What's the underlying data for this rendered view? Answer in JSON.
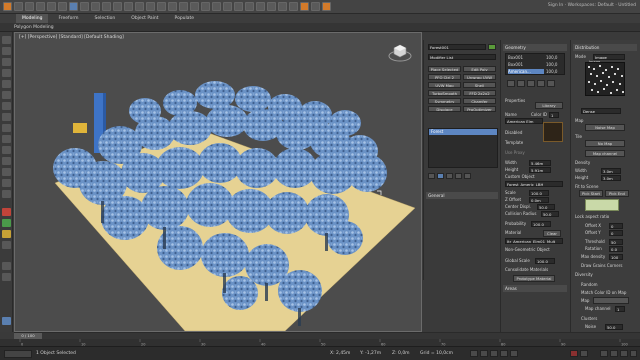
{
  "app": {
    "top_right_info": "Sign In · Workspaces: Default · Untitled"
  },
  "ribbon": {
    "tabs": [
      "Modeling",
      "Freeform",
      "Selection",
      "Object Paint",
      "Populate"
    ],
    "active_tab": "Modeling",
    "sub_label": "Polygon Modeling"
  },
  "viewport": {
    "label": "[+] [Perspective] [Standard] [Default Shading]"
  },
  "explorer": {
    "object_name": "Forest001",
    "modifier_list": "Modifier List",
    "buttons": [
      "Place Selected",
      "Edit Poly",
      "PFO Ctrl 2",
      "Unwrap UVW",
      "UVW Map",
      "Shell",
      "TurboSmooth",
      "FFD 2x2x2",
      "Symmetry",
      "Chamfer",
      "Displace",
      "ProOptimizer"
    ],
    "stack_items": [
      "Forest"
    ],
    "general_header": "General"
  },
  "geometry": {
    "header": "Geometry",
    "list_items": [
      {
        "name": "Box001",
        "value": "100,0"
      },
      {
        "name": "Box001",
        "value": "100,0"
      },
      {
        "name": "American...",
        "value": "100,0"
      }
    ],
    "properties_header": "Properties",
    "library_btn": "Library",
    "name_label": "Name",
    "name_value": "American Elm",
    "color_label": "Color ID",
    "color_value": "1",
    "disabled_label": "Disabled",
    "template_label": "Template",
    "use_proxy_label": "Use Proxy",
    "width_label": "Width",
    "width_value": "5,46m",
    "height_label": "Height",
    "height_value": "5,91m",
    "custom_object_label": "Custom Object",
    "custom_object_value": "Forest_Americ_LBH",
    "scale_label": "Scale",
    "scale_value": "100,0",
    "zoffset_label": "Z Offset",
    "zoffset_value": "0,0m",
    "center_label": "Center Displ.",
    "center_value": "50,0",
    "collision_label": "Collision Radius",
    "collision_value": "50,0",
    "probability_label": "Probability",
    "probability_value": "100,0",
    "material_label": "Material",
    "material_value": "Clear",
    "material_name": "Itr_American_Elm01_Mult",
    "non_geom_label": "Non-Geometric Object",
    "global_scale_label": "Global Scale",
    "global_scale_value": "100,0",
    "consolidate_label": "Consolidate Materials",
    "prototype_btn": "Prototype Material",
    "areas_header": "Areas"
  },
  "distribution": {
    "header": "Distribution",
    "mode_label": "Mode",
    "mode_value": "Image",
    "image_label": "Image",
    "dense_value": "Dense",
    "map_label": "Map",
    "noise_btn": "Noise Map",
    "tile_label": "Tile",
    "no_map_btn": "No Map",
    "map_channel_btn": "Map channel",
    "density_header": "Density",
    "width_label": "Width",
    "width_value": "3,0m",
    "height_label": "Height",
    "height_value": "3,0m",
    "fit_label": "Fit to Scene",
    "pick_area_btn": "Pick Start",
    "pick_end_btn": "Pick End",
    "tile_checkbox": "Lock aspect ratio",
    "offset_x_label": "Offset X",
    "offset_x_value": "0",
    "offset_y_label": "Offset Y",
    "offset_y_value": "0",
    "threshold_label": "Threshold",
    "threshold_value": "50",
    "rotation_label": "Rotation",
    "rotation_value": "0,0",
    "max_density_label": "Max density",
    "max_density_value": "100",
    "draw_corners": "Draw Grains Corners",
    "diversity_header": "Diversity",
    "random_label": "Random",
    "match_color": "Match Color ID on Map",
    "map_label2": "Map",
    "map_channel_label": "Map channel",
    "map_channel_value": "1",
    "clusters_label": "Clusters",
    "noise_label": "Noise",
    "noise_value": "50,0"
  },
  "timeline": {
    "frame": "0 / 100",
    "ticks": [
      "0",
      "10",
      "20",
      "30",
      "40",
      "50",
      "60",
      "70",
      "80",
      "90",
      "100"
    ]
  },
  "status": {
    "text": "1 Object Selected",
    "coords_x": "X: 2,45m",
    "coords_y": "Y: -1,27m",
    "coords_z": "Z: 0,0m",
    "grid": "Grid = 10,0cm"
  },
  "colors": {
    "tree": "#6b93c8",
    "ground": "#e8d49a",
    "selection": "#5d86c2"
  }
}
